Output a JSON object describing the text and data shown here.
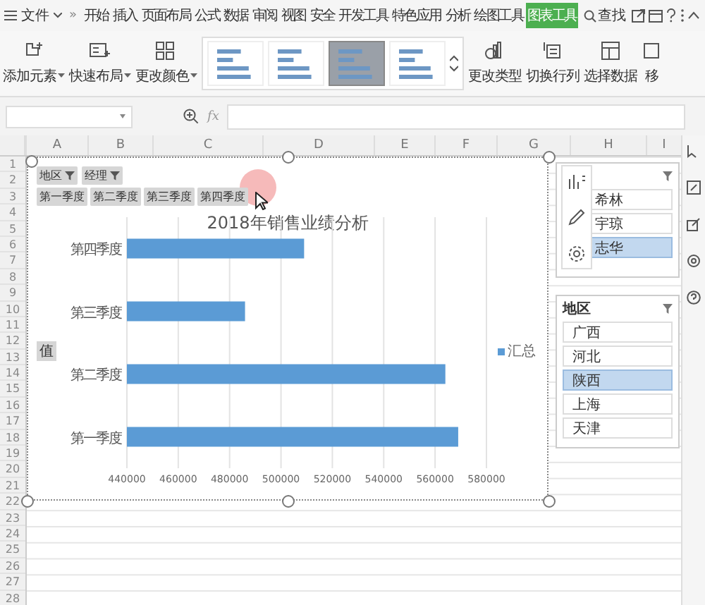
{
  "menu": {
    "file": "文件",
    "more": "»",
    "tabs": [
      {
        "label": "开始",
        "selected": false
      },
      {
        "label": "插入",
        "selected": false
      },
      {
        "label": "页面布局",
        "selected": false
      },
      {
        "label": "公式",
        "selected": false
      },
      {
        "label": "数据",
        "selected": false
      },
      {
        "label": "审阅",
        "selected": false
      },
      {
        "label": "视图",
        "selected": false
      },
      {
        "label": "安全",
        "selected": false
      },
      {
        "label": "开发工具",
        "selected": false
      },
      {
        "label": "特色应用",
        "selected": false
      },
      {
        "label": "分析",
        "selected": false
      },
      {
        "label": "绘图工具",
        "selected": false
      },
      {
        "label": "图表工具",
        "selected": true
      }
    ],
    "search": "查找"
  },
  "ribbon": {
    "left": [
      {
        "label": "添加元素",
        "dropdown": true
      },
      {
        "label": "快速布局",
        "dropdown": true
      },
      {
        "label": "更改颜色",
        "dropdown": true
      }
    ],
    "styles": [
      {
        "selected": false
      },
      {
        "selected": false
      },
      {
        "selected": true
      },
      {
        "selected": false
      }
    ],
    "right": [
      {
        "label": "更改类型"
      },
      {
        "label": "切换行列"
      },
      {
        "label": "选择数据"
      },
      {
        "label": "移"
      }
    ]
  },
  "formula_bar": {
    "fx": "fx"
  },
  "sheet": {
    "columns": [
      "A",
      "B",
      "C",
      "D",
      "E",
      "F",
      "G",
      "H",
      "I"
    ],
    "rows": [
      "1",
      "2",
      "3",
      "4",
      "5",
      "6",
      "7",
      "8",
      "9",
      "10",
      "11",
      "12",
      "13",
      "14",
      "15",
      "16",
      "17",
      "18",
      "19",
      "20",
      "21",
      "22",
      "23",
      "24",
      "25",
      "26",
      "27",
      "28"
    ]
  },
  "chart": {
    "filter_buttons": [
      "地区",
      "经理"
    ],
    "quarter_buttons": [
      "第一季度",
      "第二季度",
      "第三季度",
      "第四季度"
    ],
    "value_button": "值",
    "chart_data": {
      "type": "bar",
      "orientation": "horizontal",
      "title": "2018年销售业绩分析",
      "grid": true,
      "categories": [
        "第四季度",
        "第三季度",
        "第二季度",
        "第一季度"
      ],
      "series": [
        {
          "name": "汇总",
          "color": "#5b9bd5",
          "values": [
            509000,
            486000,
            564000,
            569000
          ]
        }
      ],
      "xlim": [
        440000,
        580000
      ],
      "xticks": [
        440000,
        460000,
        480000,
        500000,
        520000,
        540000,
        560000,
        580000
      ]
    }
  },
  "slicers": [
    {
      "items": [
        {
          "label": "希林",
          "selected": false
        },
        {
          "label": "宇琼",
          "selected": false
        },
        {
          "label": "志华",
          "selected": true
        }
      ]
    },
    {
      "title": "地区",
      "items": [
        {
          "label": "广西",
          "selected": false
        },
        {
          "label": "河北",
          "selected": false
        },
        {
          "label": "陕西",
          "selected": true
        },
        {
          "label": "上海",
          "selected": false
        },
        {
          "label": "天津",
          "selected": false
        }
      ]
    }
  ]
}
